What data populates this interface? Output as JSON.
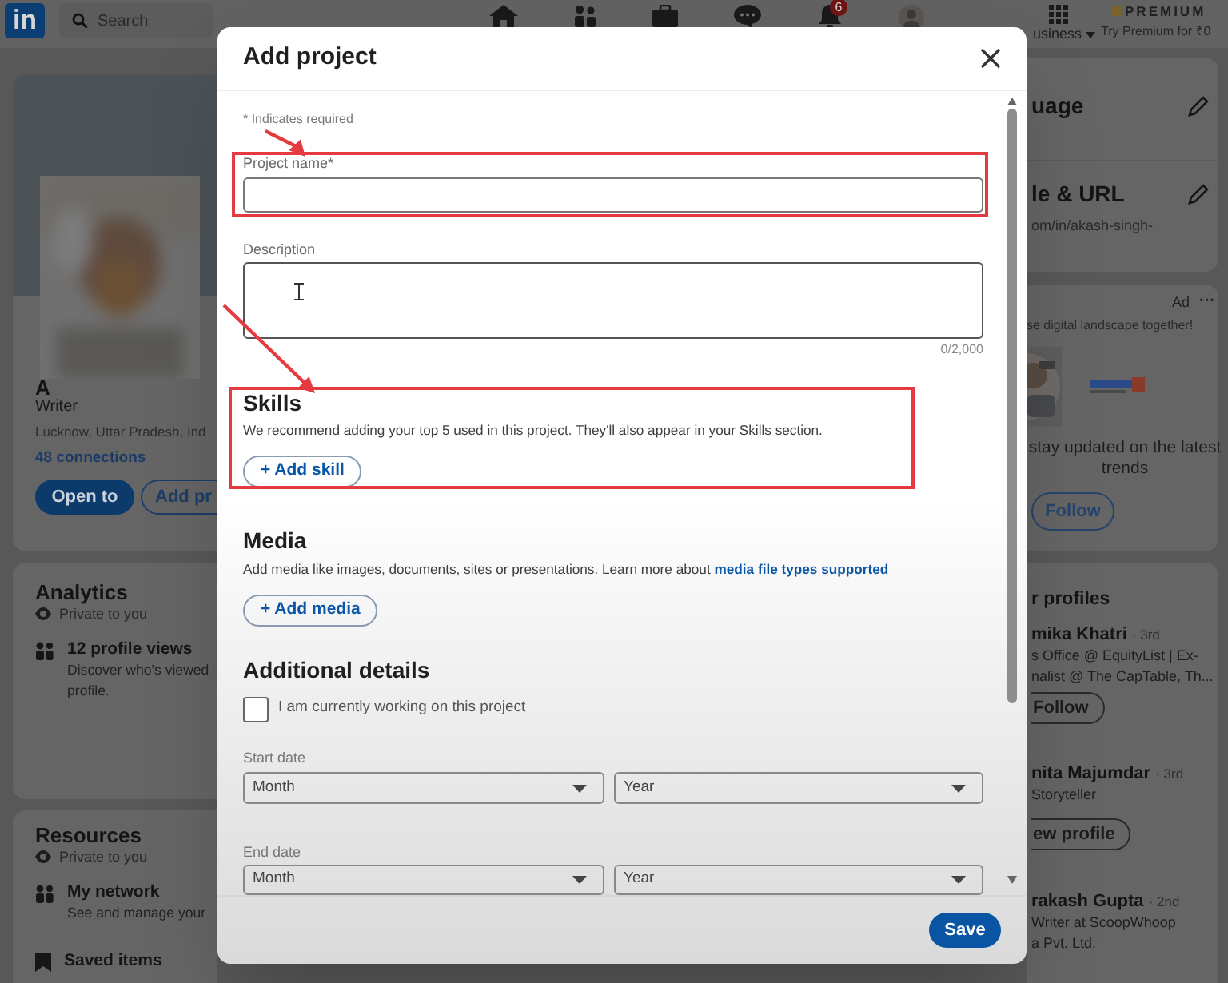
{
  "top_bar": {
    "logo": "in",
    "search_placeholder": "Search",
    "notification_count": "6",
    "business_menu": "usiness",
    "premium_label": "PREMIUM",
    "premium_offer": "Try Premium for ₹0"
  },
  "profile_card": {
    "name": "A",
    "headline": "Writer",
    "location": "Lucknow, Uttar Pradesh, Ind",
    "connections": "48 connections",
    "buttons": [
      "Open to",
      "Add pr"
    ]
  },
  "analytics": {
    "title": "Analytics",
    "visibility": "Private to you",
    "items": [
      {
        "title": "12 profile views",
        "lines": [
          "Discover who's viewed",
          "profile."
        ]
      }
    ]
  },
  "resources": {
    "title": "Resources",
    "visibility": "Private to you",
    "items": [
      {
        "title": "My network",
        "lines": [
          "See and manage your"
        ]
      },
      {
        "title": "Saved items"
      }
    ]
  },
  "right_rail": {
    "language": "uage",
    "profile_url": {
      "title": "le & URL",
      "url": "om/in/akash-singh-"
    },
    "ad": {
      "label": "Ad",
      "more": "···",
      "tagline": "se digital landscape together!",
      "lines": [
        "stay updated on the latest",
        "trends"
      ],
      "button": "Follow"
    },
    "profiles": {
      "title": "r profiles",
      "people": [
        {
          "name": "mika Khatri",
          "degree": "· 3rd",
          "lines": [
            "s Office @ EquityList | Ex-",
            "nalist @ The CapTable, Th..."
          ],
          "button": "Follow"
        },
        {
          "name": "nita Majumdar",
          "degree": "· 3rd",
          "lines": [
            "Storyteller"
          ],
          "button": "ew profile"
        },
        {
          "name": "rakash Gupta",
          "degree": "· 2nd",
          "lines": [
            "Writer at ScoopWhoop",
            "a Pvt. Ltd."
          ]
        }
      ]
    }
  },
  "dialog": {
    "title": "Add project",
    "required_note": "* Indicates required",
    "project_name": {
      "label": "Project name*"
    },
    "description": {
      "label": "Description",
      "counter": "0/2,000"
    },
    "skills": {
      "title": "Skills",
      "text": "We recommend adding your top 5 used in this project. They'll also appear in your Skills section.",
      "button": "+ Add skill"
    },
    "media": {
      "title": "Media",
      "text": "Add media like images, documents, sites or presentations. Learn more about",
      "link": "media file types supported",
      "button": "+ Add media"
    },
    "details": {
      "title": "Additional details",
      "checkbox": {
        "label": "I am currently working on this project",
        "checked": false
      },
      "dates": [
        {
          "label": "Start date",
          "selects": [
            "Month",
            "Year"
          ]
        },
        {
          "label": "End date",
          "selects": [
            "Month",
            "Year"
          ]
        }
      ]
    },
    "save_button": "Save"
  }
}
